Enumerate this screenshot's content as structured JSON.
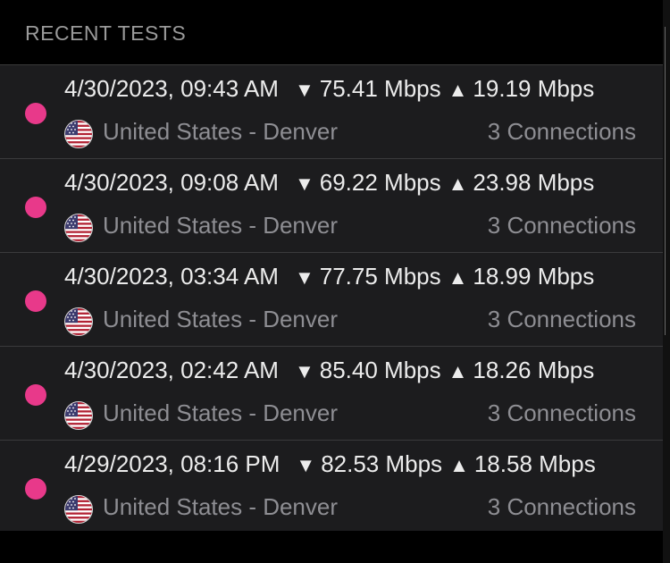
{
  "header": {
    "title": "RECENT TESTS"
  },
  "colors": {
    "status_dot": "#e8398a",
    "background": "#000000",
    "row_background": "#1c1c1e",
    "primary_text": "#ececec",
    "secondary_text": "#8e8e93"
  },
  "tests": [
    {
      "datetime": "4/30/2023, 09:43 AM",
      "down_icon": "down-triangle-icon",
      "download": "75.41 Mbps",
      "up_icon": "up-triangle-icon",
      "upload": "19.19 Mbps",
      "flag": "us-flag-icon",
      "location": "United States - Denver",
      "connections": "3 Connections"
    },
    {
      "datetime": "4/30/2023, 09:08 AM",
      "down_icon": "down-triangle-icon",
      "download": "69.22 Mbps",
      "up_icon": "up-triangle-icon",
      "upload": "23.98 Mbps",
      "flag": "us-flag-icon",
      "location": "United States - Denver",
      "connections": "3 Connections"
    },
    {
      "datetime": "4/30/2023, 03:34 AM",
      "down_icon": "down-triangle-icon",
      "download": "77.75 Mbps",
      "up_icon": "up-triangle-icon",
      "upload": "18.99 Mbps",
      "flag": "us-flag-icon",
      "location": "United States - Denver",
      "connections": "3 Connections"
    },
    {
      "datetime": "4/30/2023, 02:42 AM",
      "down_icon": "down-triangle-icon",
      "download": "85.40 Mbps",
      "up_icon": "up-triangle-icon",
      "upload": "18.26 Mbps",
      "flag": "us-flag-icon",
      "location": "United States - Denver",
      "connections": "3 Connections"
    },
    {
      "datetime": "4/29/2023, 08:16 PM",
      "down_icon": "down-triangle-icon",
      "download": "82.53 Mbps",
      "up_icon": "up-triangle-icon",
      "upload": "18.58 Mbps",
      "flag": "us-flag-icon",
      "location": "United States - Denver",
      "connections": "3 Connections"
    }
  ]
}
